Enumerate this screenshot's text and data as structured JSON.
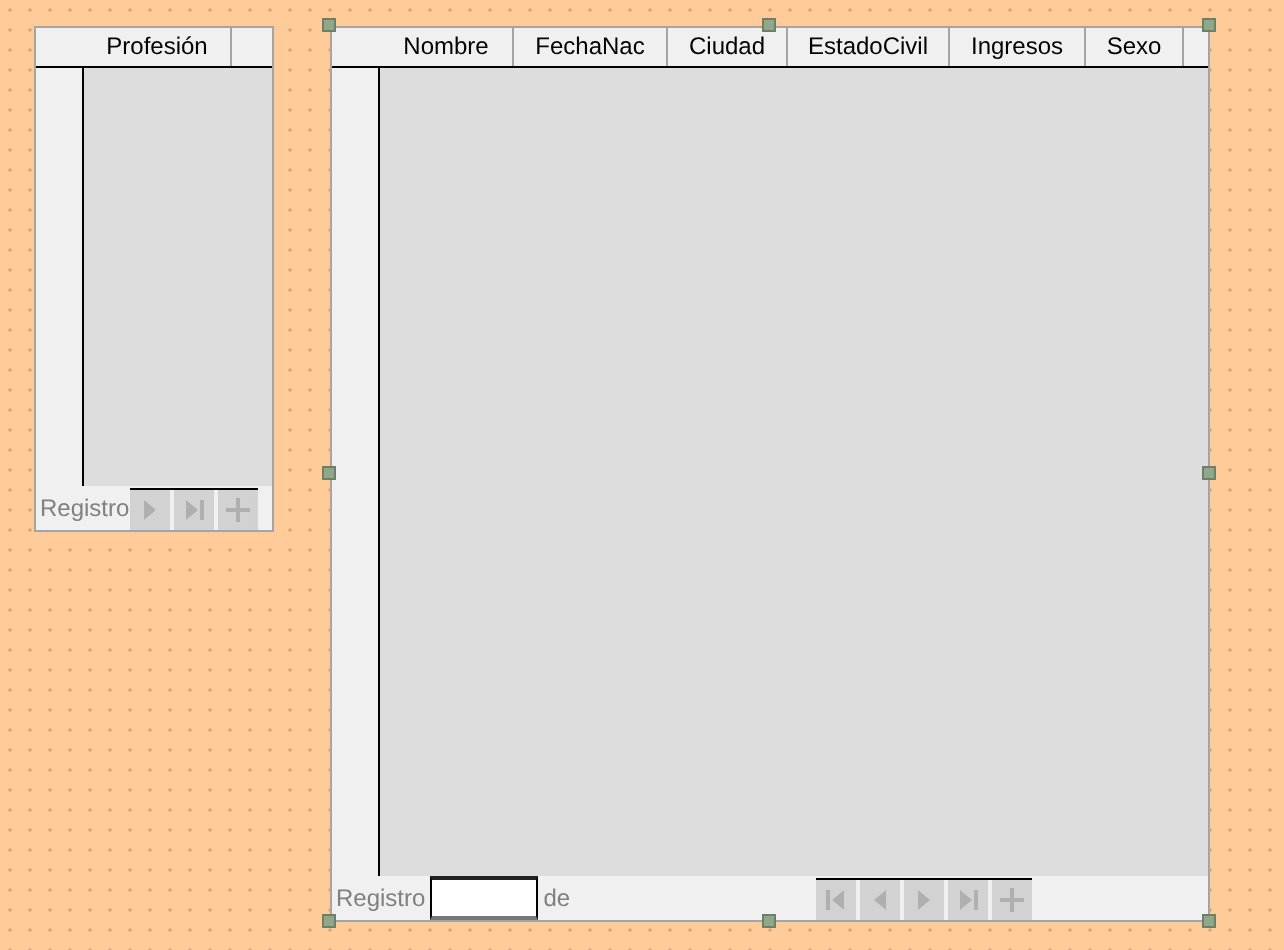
{
  "grids": [
    {
      "selected": false,
      "columns": [
        {
          "label": "Profesión"
        }
      ],
      "navigator": {
        "label": "Registro",
        "buttons": [
          {
            "kind": "next",
            "disabled": true
          },
          {
            "kind": "last",
            "disabled": true
          },
          {
            "kind": "new",
            "disabled": true
          }
        ]
      }
    },
    {
      "selected": true,
      "columns": [
        {
          "label": "Nombre"
        },
        {
          "label": "FechaNac"
        },
        {
          "label": "Ciudad"
        },
        {
          "label": "EstadoCivil"
        },
        {
          "label": "Ingresos"
        },
        {
          "label": "Sexo"
        }
      ],
      "navigator": {
        "label": "Registro",
        "of_label": "de",
        "buttons": [
          {
            "kind": "first",
            "disabled": true
          },
          {
            "kind": "prev",
            "disabled": true
          },
          {
            "kind": "next",
            "disabled": true
          },
          {
            "kind": "last",
            "disabled": true
          },
          {
            "kind": "new",
            "disabled": true
          }
        ]
      }
    }
  ]
}
